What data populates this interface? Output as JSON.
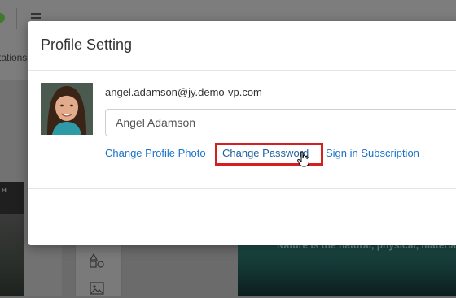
{
  "app": {
    "subbar_text": "tations",
    "canvas_caption": "Nature is the natural, physical, materia",
    "thumb_label": "H"
  },
  "modal": {
    "title": "Profile Setting",
    "email": "angel.adamson@jy.demo-vp.com",
    "name_value": "Angel Adamson",
    "links": {
      "change_photo": "Change Profile Photo",
      "change_password": "Change Password",
      "sign_in_subscription": "Sign in Subscription"
    }
  },
  "icons": [
    "menu-icon",
    "shapes-icon",
    "image-icon",
    "hand-cursor-icon"
  ],
  "colors": {
    "link": "#1a73c9",
    "highlight": "#d42020",
    "overlay": "#6b6b6b"
  }
}
